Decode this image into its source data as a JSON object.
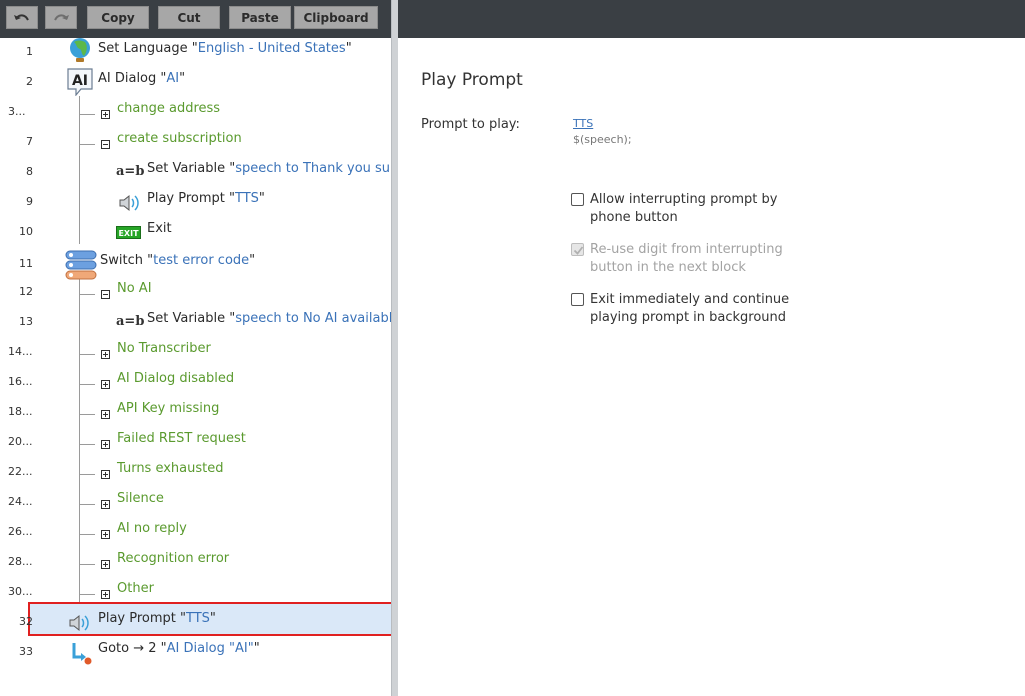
{
  "toolbar": {
    "undo_icon": "undo-icon",
    "redo_icon": "redo-icon",
    "copy": "Copy",
    "cut": "Cut",
    "paste": "Paste",
    "clipboard": "Clipboard"
  },
  "tree": {
    "rows": [
      {
        "num": "1",
        "label": "Set Language \"",
        "value": "English - United States",
        "suffix": "\""
      },
      {
        "num": "2",
        "label": "AI Dialog \"",
        "value": "AI",
        "suffix": "\""
      },
      {
        "num": "3...",
        "label": "change address"
      },
      {
        "num": "7",
        "label": "create subscription"
      },
      {
        "num": "8",
        "label": "Set Variable \"",
        "value": "speech to Thank you subsc"
      },
      {
        "num": "9",
        "label": "Play Prompt \"",
        "value": "TTS",
        "suffix": "\""
      },
      {
        "num": "10",
        "label": "Exit",
        "icon_text": "EXIT"
      },
      {
        "num": "11",
        "label": "Switch \"",
        "value": "test error code",
        "suffix": "\""
      },
      {
        "num": "12",
        "label": "No AI"
      },
      {
        "num": "13",
        "label": "Set Variable \"",
        "value": "speech to No AI available!",
        "suffix": "\""
      },
      {
        "num": "14...",
        "label": "No Transcriber"
      },
      {
        "num": "16...",
        "label": "AI Dialog disabled"
      },
      {
        "num": "18...",
        "label": "API Key missing"
      },
      {
        "num": "20...",
        "label": "Failed REST request"
      },
      {
        "num": "22...",
        "label": "Turns exhausted"
      },
      {
        "num": "24...",
        "label": "Silence"
      },
      {
        "num": "26...",
        "label": "AI no reply"
      },
      {
        "num": "28...",
        "label": "Recognition error"
      },
      {
        "num": "30...",
        "label": "Other"
      },
      {
        "num": "32",
        "label": "Play Prompt \"",
        "value": "TTS",
        "suffix": "\""
      },
      {
        "num": "33",
        "label": "Goto → 2 \"",
        "value": "AI Dialog \"AI\"",
        "suffix": "\""
      }
    ],
    "var_icon_text": "a=b",
    "ai_icon_text": "AI",
    "selected_row": "32"
  },
  "properties": {
    "title": "Play Prompt",
    "prompt_label": "Prompt to play:",
    "prompt_link": "TTS",
    "prompt_expr": "$(speech);",
    "options": [
      {
        "label": "Allow interrupting prompt by phone button",
        "checked": false,
        "disabled": false
      },
      {
        "label": "Re-use digit from interrupting button in the next block",
        "checked": true,
        "disabled": true
      },
      {
        "label": "Exit immediately and continue playing prompt in background",
        "checked": false,
        "disabled": false
      }
    ]
  },
  "colors": {
    "toolbar_bg": "#3a3f44",
    "value_blue": "#3a72b8",
    "branch_green": "#5a9a2e",
    "selection_bg": "#dae8f8",
    "selection_border": "#e02020"
  }
}
